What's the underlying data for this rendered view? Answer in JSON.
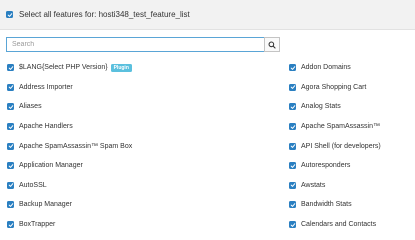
{
  "select_all": {
    "label": "Select all features for: hosti348_test_feature_list",
    "checked": true
  },
  "search": {
    "placeholder": "Search",
    "value": "",
    "icon": "search-icon"
  },
  "accent_color": "#2a7fc1",
  "badge_color": "#5bc0de",
  "features_left": [
    {
      "label": "$LANG{Select PHP Version}",
      "badge": "Plugin",
      "checked": true
    },
    {
      "label": "Address Importer",
      "checked": true
    },
    {
      "label": "Aliases",
      "checked": true
    },
    {
      "label": "Apache Handlers",
      "checked": true
    },
    {
      "label": "Apache SpamAssassin™ Spam Box",
      "checked": true
    },
    {
      "label": "Application Manager",
      "checked": true
    },
    {
      "label": "AutoSSL",
      "checked": true
    },
    {
      "label": "Backup Manager",
      "checked": true
    },
    {
      "label": "BoxTrapper",
      "checked": true
    }
  ],
  "features_right": [
    {
      "label": "Addon Domains",
      "checked": true
    },
    {
      "label": "Agora Shopping Cart",
      "checked": true
    },
    {
      "label": "Analog Stats",
      "checked": true
    },
    {
      "label": "Apache SpamAssassin™",
      "checked": true
    },
    {
      "label": "API Shell (for developers)",
      "checked": true
    },
    {
      "label": "Autoresponders",
      "checked": true
    },
    {
      "label": "Awstats",
      "checked": true
    },
    {
      "label": "Bandwidth Stats",
      "checked": true
    },
    {
      "label": "Calendars and Contacts",
      "checked": true
    }
  ]
}
